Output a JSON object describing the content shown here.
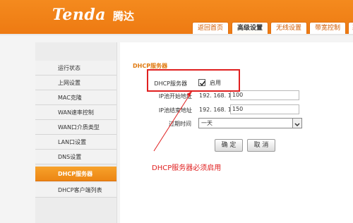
{
  "header": {
    "logo": "Tenda",
    "logo_cn": "腾达",
    "tabs": [
      {
        "label": "返回首页"
      },
      {
        "label": "高级设置"
      },
      {
        "label": "无线设置"
      },
      {
        "label": "带宽控制"
      },
      {
        "label": "系"
      }
    ]
  },
  "sidebar": {
    "items": [
      {
        "label": "运行状态"
      },
      {
        "label": "上网设置"
      },
      {
        "label": "MAC克隆"
      },
      {
        "label": "WAN速率控制"
      },
      {
        "label": "WAN口介质类型"
      },
      {
        "label": "LAN口设置"
      },
      {
        "label": "DNS设置"
      },
      {
        "label": "DHCP服务器"
      },
      {
        "label": "DHCP客户端列表"
      }
    ]
  },
  "main": {
    "section_title": "DHCP服务器",
    "dhcp_label": "DHCP服务器",
    "enable_label": "启用",
    "enable_checked": true,
    "start_ip_label": "IP池开始地址",
    "start_ip_prefix": "192. 168. 10.",
    "start_ip_value": "100",
    "end_ip_label": "IP池结束地址",
    "end_ip_prefix": "192. 168. 10.",
    "end_ip_value": "150",
    "lease_label": "过期时间",
    "lease_value": "一天",
    "ok_button": "确 定",
    "cancel_button": "取 消"
  },
  "annotation": {
    "text": "DHCP服务器必须启用",
    "color": "#e02020"
  },
  "colors": {
    "brand": "#ef7d14",
    "active_nav": "#f29220"
  }
}
